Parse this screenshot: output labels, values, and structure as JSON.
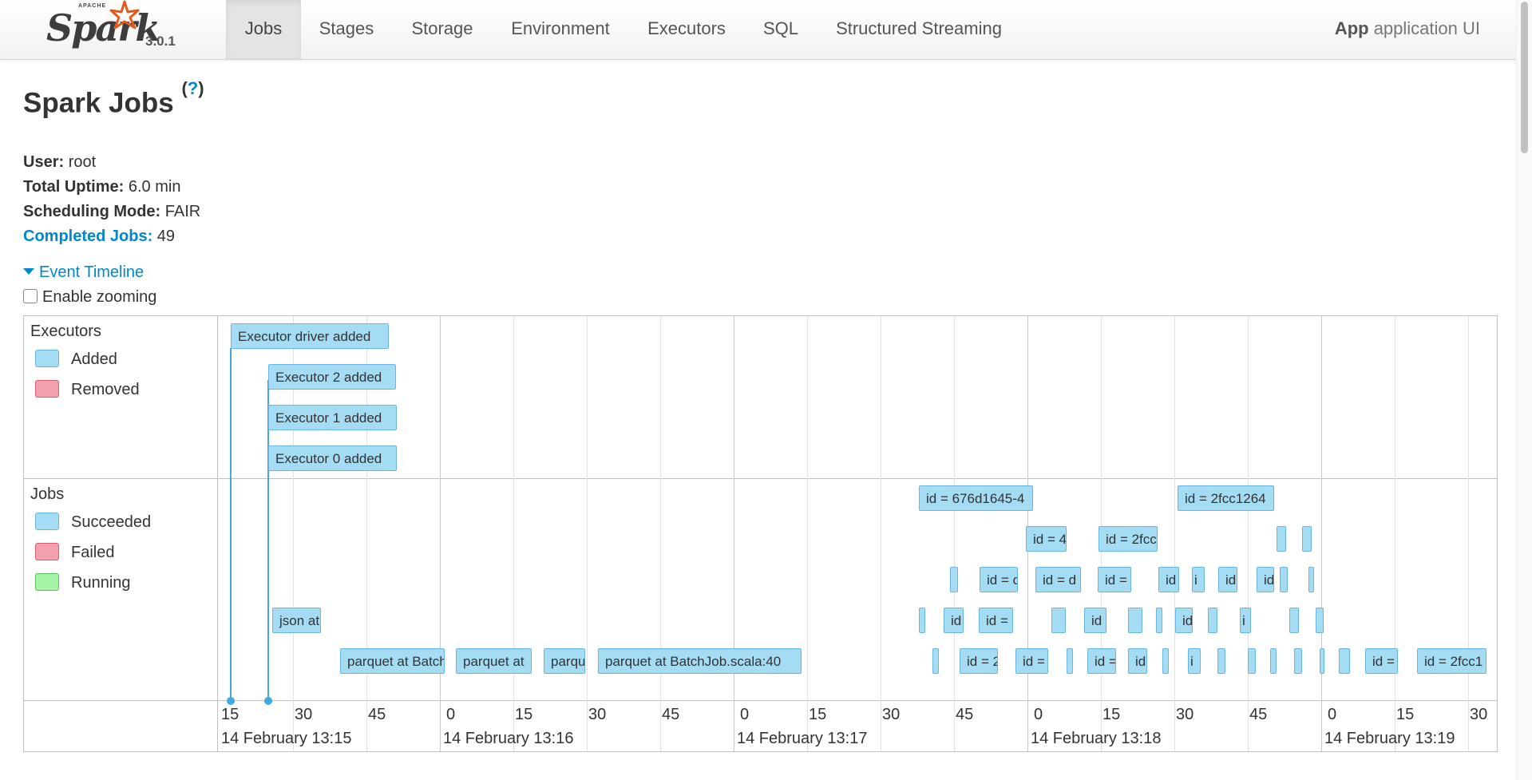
{
  "brand": {
    "apache": "APACHE",
    "name": "Spark",
    "version": "3.0.1"
  },
  "nav": {
    "tabs": [
      {
        "label": "Jobs",
        "x": 0,
        "w": 0
      },
      {
        "label": "Stages"
      },
      {
        "label": "Storage"
      },
      {
        "label": "Environment"
      },
      {
        "label": "Executors"
      },
      {
        "label": "SQL"
      },
      {
        "label": "Structured Streaming"
      }
    ],
    "active": "Jobs",
    "app_ui_bold": "App",
    "app_ui_rest": " application UI"
  },
  "page": {
    "title": "Spark Jobs",
    "help": "?",
    "user_label": "User:",
    "user_value": " root",
    "uptime_label": "Total Uptime:",
    "uptime_value": " 6.0 min",
    "mode_label": "Scheduling Mode:",
    "mode_value": " FAIR",
    "completed_label": "Completed Jobs:",
    "completed_value": " 49",
    "timeline_toggle": "Event Timeline",
    "zoom_label": "Enable zooming"
  },
  "timeline": {
    "executors_title": "Executors",
    "jobs_title": "Jobs",
    "legend_executors": [
      {
        "label": "Added",
        "color": "#a4dcf4"
      },
      {
        "label": "Removed",
        "color": "#f4a0ac"
      }
    ],
    "legend_jobs": [
      {
        "label": "Succeeded",
        "color": "#a4dcf4"
      },
      {
        "label": "Failed",
        "color": "#f4a0ac"
      },
      {
        "label": "Running",
        "color": "#a6f4a8"
      }
    ],
    "executor_events": [
      "Executor driver added",
      "Executor 2 added",
      "Executor 1 added",
      "Executor 0 added"
    ],
    "job_labels": {
      "r1a": "id = 676d1645-4",
      "r1b": "id = 2fcc1264",
      "r2a": "id = 4",
      "r2b": "id = 2fcc",
      "r3a": "id = c",
      "r3b": "id = d",
      "r3c": "id =",
      "r3d": "id",
      "r3e": "i",
      "r3f": "id",
      "r3g": "id",
      "r4a": "json at",
      "r4b": "id",
      "r4c": "id =",
      "r4d": "id",
      "r4e": "id",
      "r4f": "id",
      "r4g": "id",
      "r4h": "i",
      "r5a": "parquet at BatchJob",
      "r5b": "parquet at",
      "r5c": "parquet",
      "r5d": "parquet at BatchJob.scala:40",
      "r5e": "id = 2",
      "r5f": "id =",
      "r5g": "id =",
      "r5h": "id",
      "r5i": "i",
      "r5j": "id =",
      "r5k": "id = 2fcc1"
    },
    "ticks": [
      "15",
      "30",
      "45",
      "0",
      "15",
      "30",
      "45",
      "0",
      "15",
      "30",
      "45",
      "0",
      "15",
      "30",
      "45",
      "0",
      "15",
      "30"
    ],
    "dates": [
      "14 February 13:15",
      "14 February 13:16",
      "14 February 13:17",
      "14 February 13:18",
      "14 February 13:19"
    ]
  }
}
